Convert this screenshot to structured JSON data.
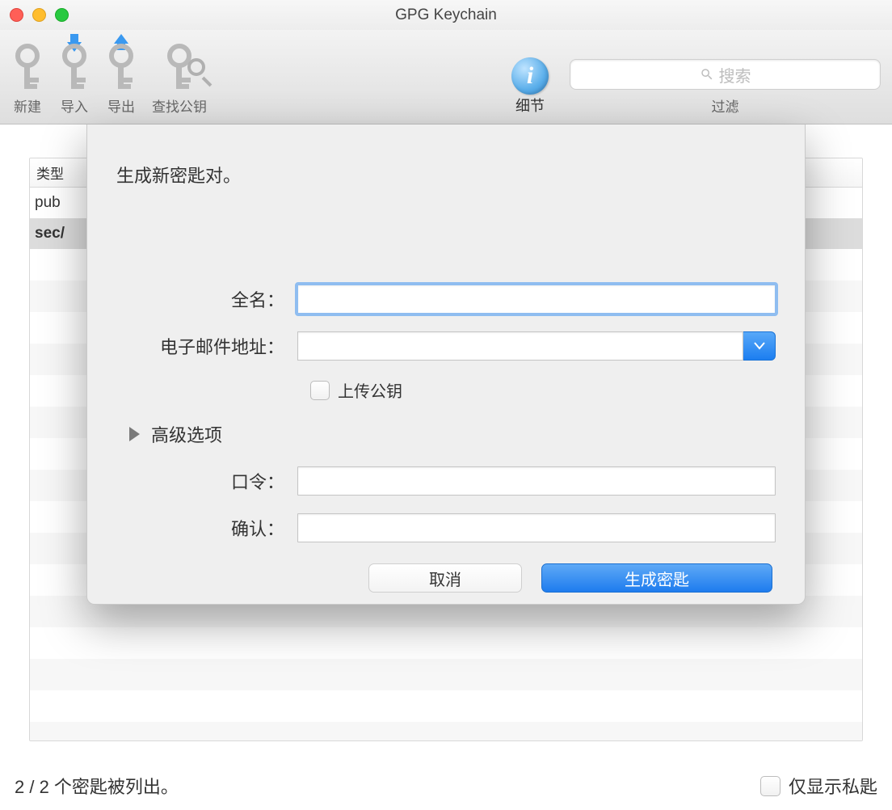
{
  "window": {
    "title": "GPG Keychain"
  },
  "toolbar": {
    "new_label": "新建",
    "import_label": "导入",
    "export_label": "导出",
    "find_label": "查找公钥",
    "details_label": "细节",
    "filter_label": "过滤",
    "search_placeholder": "搜索"
  },
  "table": {
    "column_type": "类型",
    "rows": [
      "pub",
      "sec/"
    ]
  },
  "footer": {
    "status": "2 / 2 个密匙被列出。",
    "only_private_label": "仅显示私匙"
  },
  "sheet": {
    "title": "生成新密匙对。",
    "fullname_label": "全名：",
    "email_label": "电子邮件地址：",
    "upload_label": "上传公钥",
    "advanced_label": "高级选项",
    "passphrase_label": "口令：",
    "confirm_label": "确认：",
    "cancel_label": "取消",
    "generate_label": "生成密匙",
    "fullname_value": "",
    "email_value": "",
    "passphrase_value": "",
    "confirm_value": ""
  }
}
